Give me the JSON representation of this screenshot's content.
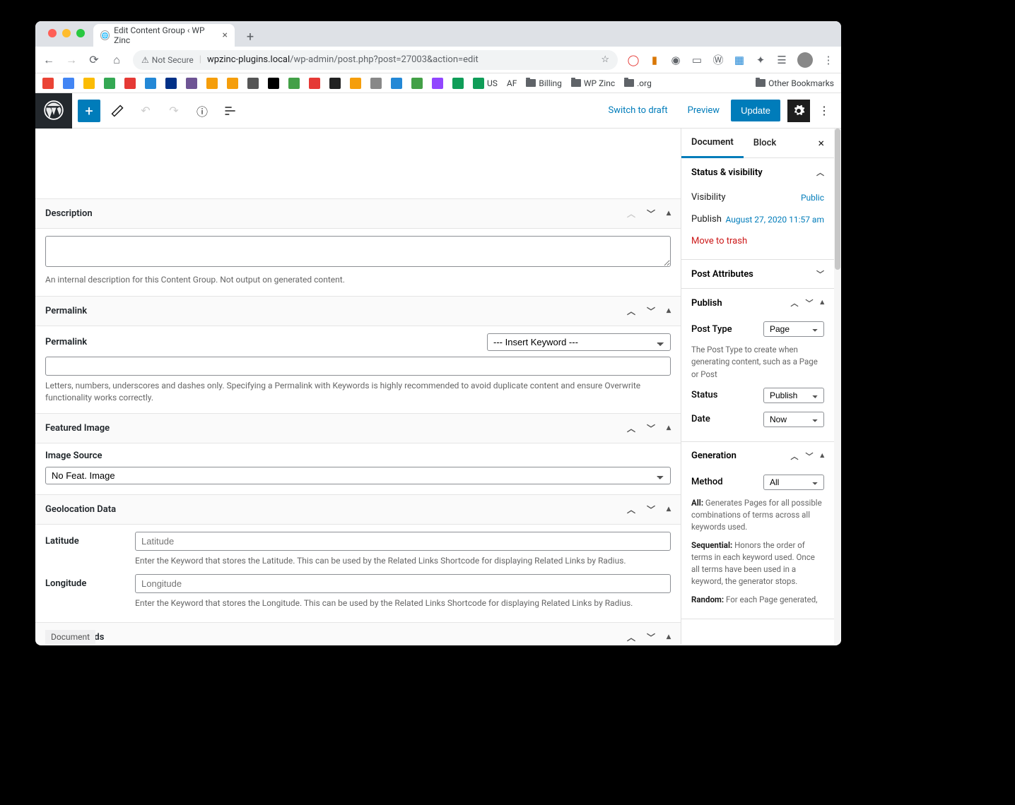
{
  "browser": {
    "tab_title": "Edit Content Group ‹ WP Zinc",
    "not_secure": "Not Secure",
    "url_domain": "wpzinc-plugins.local",
    "url_path": "/wp-admin/post.php?post=27003&action=edit",
    "bookmarks_text": {
      "af": "AF",
      "billing": "Billing",
      "wpzinc": "WP Zinc",
      "org": ".org",
      "us": "US",
      "other": "Other Bookmarks"
    }
  },
  "toolbar": {
    "switch_draft": "Switch to draft",
    "preview": "Preview",
    "update": "Update"
  },
  "panels": {
    "description": {
      "title": "Description",
      "help": "An internal description for this Content Group. Not output on generated content."
    },
    "permalink": {
      "title": "Permalink",
      "label": "Permalink",
      "insert_keyword": "--- Insert Keyword ---",
      "help": "Letters, numbers, underscores and dashes only. Specifying a Permalink with Keywords is highly recommended to avoid duplicate content and ensure Overwrite functionality works correctly."
    },
    "featured": {
      "title": "Featured Image",
      "image_source": "Image Source",
      "no_feat": "No Feat. Image"
    },
    "geo": {
      "title": "Geolocation Data",
      "lat_label": "Latitude",
      "lat_placeholder": "Latitude",
      "lat_help": "Enter the Keyword that stores the Latitude. This can be used by the Related Links Shortcode for displaying Related Links by Radius.",
      "lon_label": "Longitude",
      "lon_placeholder": "Longitude",
      "lon_help": "Enter the Keyword that stores the Longitude. This can be used by the Related Links Shortcode for displaying Related Links by Radius."
    },
    "custom_fields": {
      "title": "Custom Fields"
    }
  },
  "sidebar": {
    "tab_document": "Document",
    "tab_block": "Block",
    "status_visibility": "Status & visibility",
    "visibility_label": "Visibility",
    "visibility_value": "Public",
    "publish_label": "Publish",
    "publish_value": "August 27, 2020 11:57 am",
    "move_trash": "Move to trash",
    "post_attributes": "Post Attributes",
    "publish_section": "Publish",
    "post_type_label": "Post Type",
    "post_type_value": "Page",
    "post_type_help": "The Post Type to create when generating content, such as a Page or Post",
    "status_label": "Status",
    "status_value": "Publish",
    "date_label": "Date",
    "date_value": "Now",
    "generation": "Generation",
    "method_label": "Method",
    "method_value": "All",
    "help_all_label": "All:",
    "help_all": " Generates Pages for all possible combinations of terms across all keywords used.",
    "help_seq_label": "Sequential:",
    "help_seq": " Honors the order of terms in each keyword used. Once all terms have been used in a keyword, the generator stops.",
    "help_rand_label": "Random:",
    "help_rand": " For each Page generated,"
  },
  "status_bar": "Document"
}
